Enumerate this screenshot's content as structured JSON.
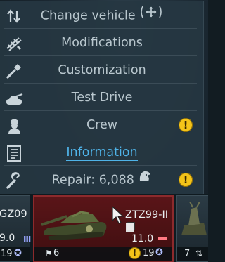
{
  "menu": {
    "items": [
      {
        "id": "change-vehicle",
        "icon": "swap-arrows-icon",
        "label": "Change vehicle"
      },
      {
        "id": "modifications",
        "icon": "modifications-icon",
        "label": "Modifications"
      },
      {
        "id": "customization",
        "icon": "paint-brush-icon",
        "label": "Customization"
      },
      {
        "id": "test-drive",
        "icon": "tank-icon",
        "label": "Test Drive"
      },
      {
        "id": "crew",
        "icon": "crew-icon",
        "label": "Crew"
      },
      {
        "id": "information",
        "icon": "info-document-icon",
        "label": "Information"
      },
      {
        "id": "repair",
        "icon": "wrench-icon",
        "label": "Repair: 6,088"
      }
    ]
  },
  "slots": {
    "left": {
      "name": "GZ09",
      "br": "9.0",
      "crew": "19"
    },
    "selected": {
      "name": "ZTZ99-II",
      "br": "11.0",
      "count_left": "6",
      "crew": "19"
    },
    "right": {
      "count": "7"
    }
  },
  "colors": {
    "menu_bg": "#263742",
    "label": "#b9c7ce",
    "link": "#4fb3e8",
    "warning": "#f4c419",
    "selected_slot": "#5a1518"
  }
}
